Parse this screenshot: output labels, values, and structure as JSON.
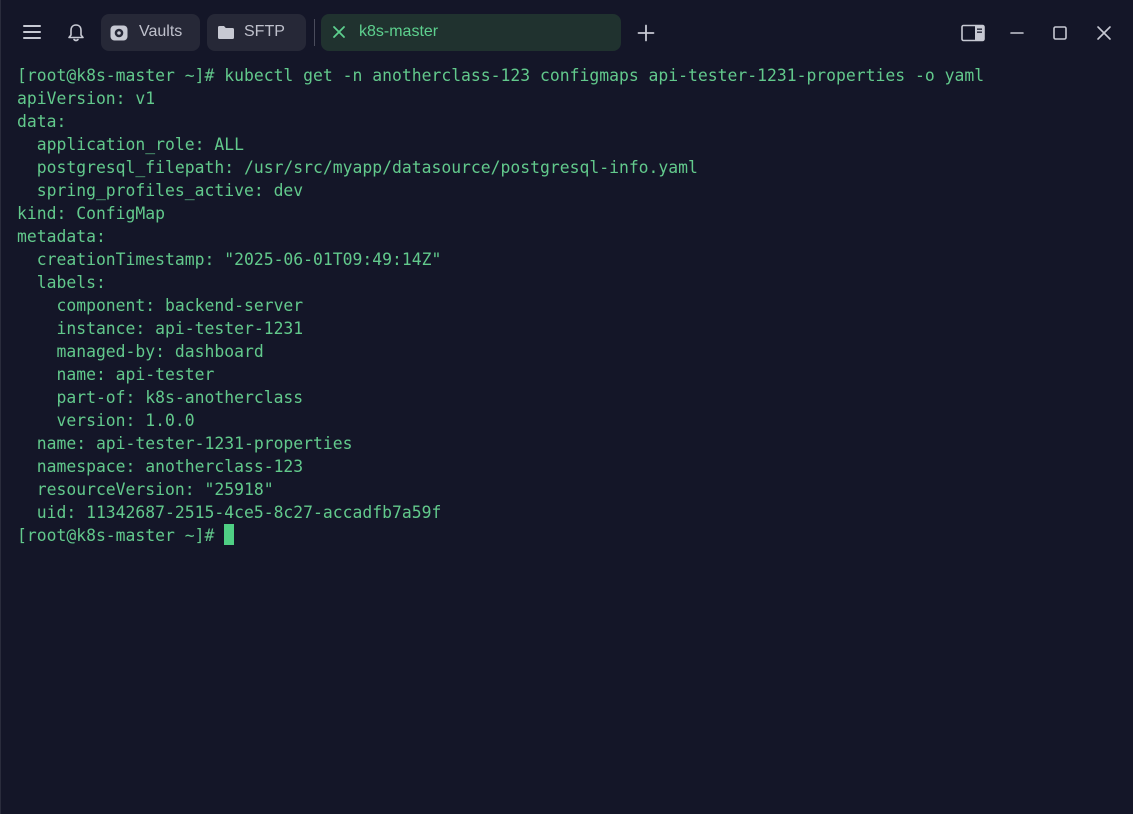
{
  "titlebar": {
    "menu_icon": "hamburger-menu-icon",
    "notifications_icon": "bell-icon",
    "tabs": [
      {
        "label": "Vaults",
        "icon": "vault-icon",
        "active": false
      },
      {
        "label": "SFTP",
        "icon": "folder-icon",
        "active": false
      },
      {
        "label": "k8s-master",
        "icon": "close-icon",
        "active": true
      }
    ],
    "new_tab_icon": "plus-icon",
    "window_controls": [
      "toggle-sidebar-icon",
      "minimize-icon",
      "maximize-icon",
      "close-window-icon"
    ]
  },
  "colors": {
    "background": "#141628",
    "terminal_text": "#62c98c",
    "active_tab_bg": "#20322f",
    "active_tab_text": "#5dd08e",
    "inactive_tab_bg": "#262837",
    "cursor": "#4fcf84"
  },
  "terminal": {
    "lines": [
      "[root@k8s-master ~]# kubectl get -n anotherclass-123 configmaps api-tester-1231-properties -o yaml",
      "apiVersion: v1",
      "data:",
      "  application_role: ALL",
      "  postgresql_filepath: /usr/src/myapp/datasource/postgresql-info.yaml",
      "  spring_profiles_active: dev",
      "kind: ConfigMap",
      "metadata:",
      "  creationTimestamp: \"2025-06-01T09:49:14Z\"",
      "  labels:",
      "    component: backend-server",
      "    instance: api-tester-1231",
      "    managed-by: dashboard",
      "    name: api-tester",
      "    part-of: k8s-anotherclass",
      "    version: 1.0.0",
      "  name: api-tester-1231-properties",
      "  namespace: anotherclass-123",
      "  resourceVersion: \"25918\"",
      "  uid: 11342687-2515-4ce5-8c27-accadfb7a59f"
    ],
    "prompt": "[root@k8s-master ~]# "
  }
}
